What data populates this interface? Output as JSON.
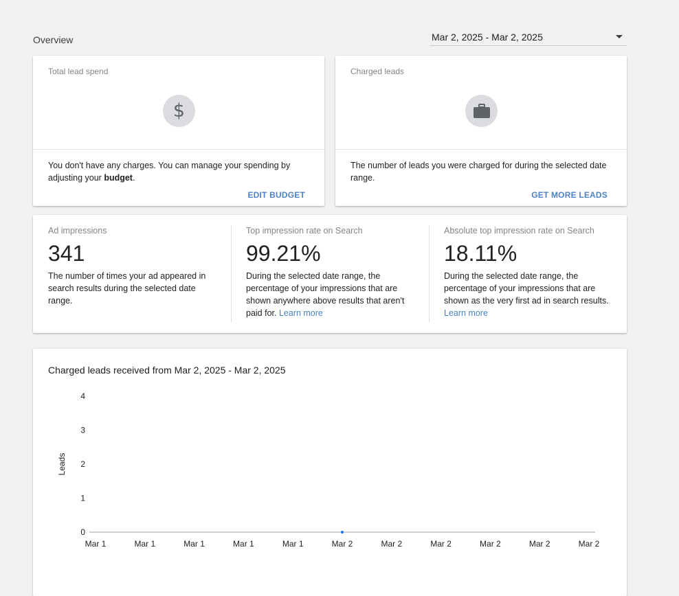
{
  "overview": {
    "title": "Overview"
  },
  "date_range": {
    "value": "Mar 2, 2025 - Mar 2, 2025"
  },
  "spend_card": {
    "label": "Total lead spend",
    "icon": "dollar-icon",
    "desc_prefix": "You don't have any charges. You can manage your spending by adjusting your ",
    "desc_bold": "budget",
    "desc_suffix": ".",
    "action": "EDIT BUDGET"
  },
  "leads_card": {
    "label": "Charged leads",
    "icon": "briefcase-icon",
    "desc": "The number of leads you were charged for during the selected date range.",
    "action": "GET MORE LEADS"
  },
  "metrics": [
    {
      "label": "Ad impressions",
      "value": "341",
      "desc": "The number of times your ad appeared in search results during the selected date range.",
      "link": ""
    },
    {
      "label": "Top impression rate on Search",
      "value": "99.21%",
      "desc": "During the selected date range, the percentage of your impressions that are shown anywhere above results that aren't paid for. ",
      "link": "Learn more"
    },
    {
      "label": "Absolute top impression rate on Search",
      "value": "18.11%",
      "desc": "During the selected date range, the percentage of your impressions that are shown as the very first ad in search results. ",
      "link": "Learn more"
    }
  ],
  "colors": {
    "accent": "#4d82c4",
    "chart_line": "#1a73e8"
  },
  "chart_data": {
    "type": "line",
    "title": "Charged leads received from Mar 2, 2025 - Mar 2, 2025",
    "xlabel": "",
    "ylabel": "Leads",
    "categories": [
      "Mar 1",
      "Mar 1",
      "Mar 1",
      "Mar 1",
      "Mar 1",
      "Mar 2",
      "Mar 2",
      "Mar 2",
      "Mar 2",
      "Mar 2",
      "Mar 2"
    ],
    "y_ticks": [
      0,
      1,
      2,
      3,
      4
    ],
    "ylim": [
      0,
      4
    ],
    "grid": false,
    "series": [
      {
        "values": [
          0
        ]
      }
    ],
    "points_at_category_index": [
      5
    ]
  }
}
